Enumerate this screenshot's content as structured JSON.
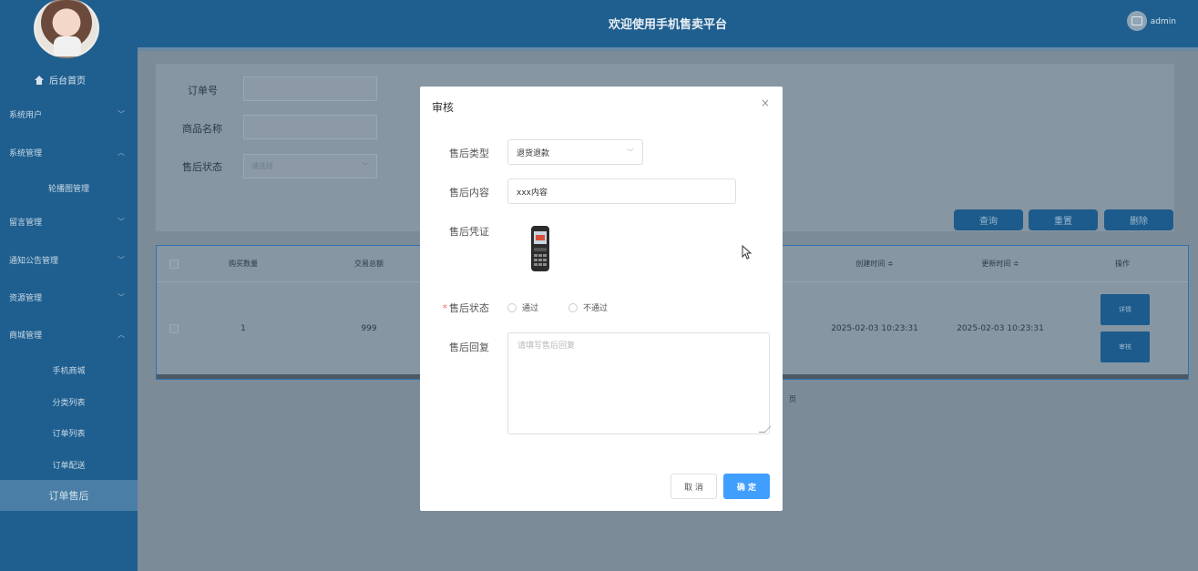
{
  "header": {
    "title": "欢迎使用手机售卖平台",
    "user": "admin"
  },
  "sidebar": {
    "home": "后台首页",
    "items": [
      {
        "label": "系统用户",
        "chevron": "﹀"
      },
      {
        "label": "系统管理",
        "chevron": "︿"
      },
      {
        "label": "轮播图管理",
        "sub": true
      },
      {
        "label": "留言管理",
        "chevron": "﹀"
      },
      {
        "label": "通知公告管理",
        "chevron": "﹀"
      },
      {
        "label": "资源管理",
        "chevron": "﹀"
      },
      {
        "label": "商城管理",
        "chevron": "︿"
      }
    ],
    "mall_sub": [
      "手机商城",
      "分类列表",
      "订单列表",
      "订单配送",
      "订单售后"
    ]
  },
  "search": {
    "order_no_label": "订单号",
    "product_name_label": "商品名称",
    "status_label": "售后状态",
    "status_placeholder": "请选择",
    "buttons": {
      "query": "查询",
      "reset": "重置",
      "delete": "删除"
    }
  },
  "table": {
    "headers": [
      "购买数量",
      "交易总额",
      "创建时间 ≑",
      "更新时间 ≑",
      "操作"
    ],
    "row": {
      "qty": "1",
      "total": "999",
      "created": "2025-02-03 10:23:31",
      "updated": "2025-02-03 10:23:31",
      "detail_btn": "详情",
      "review_btn": "审核"
    },
    "pagination_text": "页"
  },
  "modal": {
    "title": "审核",
    "close": "×",
    "type_label": "售后类型",
    "type_value": "退货退款",
    "content_label": "售后内容",
    "content_value": "xxx内容",
    "proof_label": "售后凭证",
    "status_label": "售后状态",
    "status_required": "*",
    "options": [
      "通过",
      "不通过"
    ],
    "reply_label": "售后回复",
    "reply_placeholder": "请填写售后回复",
    "cancel": "取 消",
    "confirm": "确 定"
  },
  "colors": {
    "primary": "#409eff",
    "sidebar": "#1f5f8f",
    "required": "#f56c6c"
  }
}
